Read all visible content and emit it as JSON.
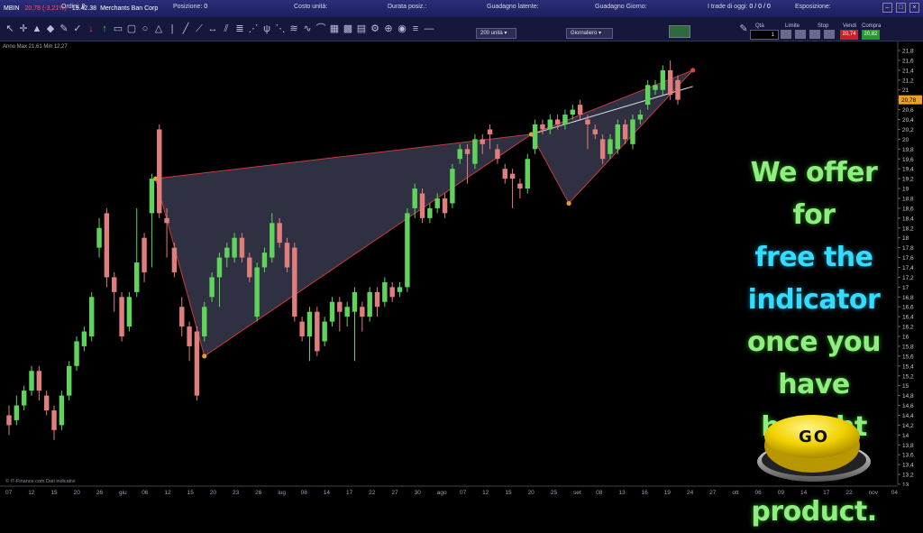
{
  "header": {
    "symbol": "MBIN",
    "change": "20,78 (-3,21%)",
    "time": "19.42.38",
    "name": "Merchants Ban Corp",
    "fields": [
      {
        "label": "Ordini:",
        "value": "0"
      },
      {
        "label": "Posizione:",
        "value": "0"
      },
      {
        "label": "Costo unità:",
        "value": ""
      },
      {
        "label": "Durata posiz.:",
        "value": ""
      },
      {
        "label": "Guadagno latente:",
        "value": ""
      },
      {
        "label": "Guadagno Giorno:",
        "value": ""
      },
      {
        "label": "I trade di oggi:",
        "value": "0 / 0 / 0"
      },
      {
        "label": "Esposizione:",
        "value": ""
      }
    ]
  },
  "toolbar": {
    "units_select": "200 unità",
    "period_select": "Giornaliero",
    "qty_label": "Qtà",
    "qty_value": "1",
    "limit_label": "Limite",
    "stop_label": "Stop",
    "sell_label": "Vendi",
    "sell_price": "20,74",
    "buy_label": "Compra",
    "buy_price": "20,82",
    "sell_color": "#c8202a",
    "buy_color": "#1f9a2e"
  },
  "chart_info": "Anno Max 21,61 Min 12,27",
  "price_tag": "20,78",
  "footer": "© IT-Finance.com Dati indicativi",
  "promo": {
    "lines": [
      "We offer for",
      "free the",
      "indicator",
      "once you",
      "have bought",
      "this product."
    ],
    "go_label": "GO"
  },
  "chart_data": {
    "type": "candlestick",
    "y_ticks": [
      "21,8",
      "21,6",
      "21,4",
      "21,2",
      "21",
      "20,8",
      "20,6",
      "20,4",
      "20,2",
      "20",
      "19,8",
      "19,6",
      "19,4",
      "19,2",
      "19",
      "18,8",
      "18,6",
      "18,4",
      "18,2",
      "18",
      "17,8",
      "17,6",
      "17,4",
      "17,2",
      "17",
      "16,8",
      "16,6",
      "16,4",
      "16,2",
      "16",
      "15,8",
      "15,6",
      "15,4",
      "15,2",
      "15",
      "14,8",
      "14,6",
      "14,4",
      "14,2",
      "14",
      "13,8",
      "13,6",
      "13,4",
      "13,2",
      "13"
    ],
    "ylim": [
      13,
      21.8
    ],
    "x_labels": [
      "07",
      "12",
      "15",
      "20",
      "26",
      "giu",
      "06",
      "12",
      "15",
      "20",
      "23",
      "26",
      "lug",
      "08",
      "14",
      "17",
      "22",
      "27",
      "30",
      "ago",
      "07",
      "12",
      "15",
      "20",
      "25",
      "set",
      "08",
      "13",
      "16",
      "19",
      "24",
      "27",
      "ott",
      "06",
      "09",
      "14",
      "17",
      "22",
      "nov",
      "04"
    ],
    "candles": [
      [
        14.4,
        14.2,
        14.6,
        14.0
      ],
      [
        14.3,
        14.6,
        14.8,
        14.2
      ],
      [
        14.6,
        14.9,
        15.0,
        14.5
      ],
      [
        14.9,
        15.3,
        15.4,
        14.8
      ],
      [
        15.3,
        14.9,
        15.4,
        14.7
      ],
      [
        14.8,
        14.5,
        14.9,
        14.4
      ],
      [
        14.5,
        14.1,
        14.6,
        13.9
      ],
      [
        14.2,
        14.8,
        14.9,
        14.1
      ],
      [
        14.8,
        15.4,
        15.5,
        14.7
      ],
      [
        15.4,
        15.9,
        16.0,
        15.3
      ],
      [
        15.8,
        16.1,
        16.2,
        15.7
      ],
      [
        16.0,
        16.8,
        16.9,
        15.9
      ],
      [
        17.8,
        18.2,
        18.4,
        17.6
      ],
      [
        18.5,
        17.2,
        18.6,
        17.0
      ],
      [
        17.2,
        16.9,
        17.3,
        16.5
      ],
      [
        16.8,
        16.0,
        16.9,
        15.9
      ],
      [
        16.2,
        16.8,
        16.9,
        16.1
      ],
      [
        16.9,
        17.5,
        18.6,
        16.8
      ],
      [
        18.0,
        17.3,
        18.1,
        17.1
      ],
      [
        18.5,
        19.2,
        19.3,
        17.4
      ],
      [
        20.2,
        18.5,
        20.3,
        18.4
      ],
      [
        18.4,
        18.3,
        18.6,
        17.6
      ],
      [
        17.8,
        17.3,
        17.9,
        17.2
      ],
      [
        16.6,
        16.2,
        16.8,
        16.0
      ],
      [
        16.2,
        15.8,
        16.3,
        15.5
      ],
      [
        16.1,
        14.8,
        16.2,
        14.7
      ],
      [
        16.0,
        16.6,
        16.7,
        15.9
      ],
      [
        16.8,
        17.2,
        17.3,
        16.7
      ],
      [
        17.2,
        17.6,
        17.7,
        16.6
      ],
      [
        17.6,
        17.8,
        17.9,
        17.4
      ],
      [
        17.6,
        18.0,
        18.1,
        17.5
      ],
      [
        18.0,
        17.6,
        18.1,
        17.5
      ],
      [
        17.6,
        17.2,
        17.7,
        17.1
      ],
      [
        16.4,
        17.4,
        17.5,
        16.3
      ],
      [
        17.4,
        17.7,
        17.8,
        17.3
      ],
      [
        17.6,
        18.3,
        18.5,
        17.5
      ],
      [
        18.3,
        17.9,
        18.4,
        17.8
      ],
      [
        17.9,
        17.4,
        18.0,
        17.3
      ],
      [
        17.8,
        16.4,
        17.9,
        16.3
      ],
      [
        16.3,
        16.0,
        16.4,
        15.9
      ],
      [
        16.0,
        16.5,
        16.6,
        15.5
      ],
      [
        16.5,
        15.7,
        16.6,
        15.6
      ],
      [
        15.9,
        16.3,
        16.4,
        15.8
      ],
      [
        16.3,
        16.7,
        16.8,
        16.2
      ],
      [
        16.7,
        16.5,
        16.8,
        16.1
      ],
      [
        16.4,
        16.6,
        16.7,
        16.2
      ],
      [
        16.5,
        16.9,
        17.0,
        15.5
      ],
      [
        16.6,
        16.4,
        16.7,
        16.1
      ],
      [
        16.4,
        16.9,
        17.0,
        16.3
      ],
      [
        16.9,
        16.6,
        17.0,
        16.4
      ],
      [
        16.7,
        17.1,
        17.2,
        16.6
      ],
      [
        17.0,
        16.8,
        17.1,
        16.7
      ],
      [
        16.9,
        17.0,
        17.1,
        16.8
      ],
      [
        17.0,
        18.5,
        18.6,
        16.9
      ],
      [
        18.6,
        19.0,
        19.1,
        18.4
      ],
      [
        18.9,
        18.4,
        19.0,
        18.3
      ],
      [
        18.4,
        18.6,
        18.7,
        18.3
      ],
      [
        18.6,
        18.8,
        18.9,
        18.5
      ],
      [
        18.8,
        18.5,
        18.9,
        18.4
      ],
      [
        18.7,
        19.4,
        19.5,
        18.6
      ],
      [
        19.6,
        19.8,
        19.9,
        19.5
      ],
      [
        19.8,
        19.7,
        19.9,
        19.1
      ],
      [
        19.5,
        20.0,
        20.1,
        19.4
      ],
      [
        20.0,
        19.9,
        20.1,
        19.7
      ],
      [
        20.2,
        20.1,
        20.3,
        19.8
      ],
      [
        19.8,
        19.6,
        19.9,
        19.5
      ],
      [
        19.4,
        19.2,
        19.5,
        19.1
      ],
      [
        19.3,
        19.2,
        19.4,
        18.6
      ],
      [
        19.1,
        19.0,
        19.2,
        18.8
      ],
      [
        19.0,
        19.6,
        19.7,
        18.9
      ],
      [
        19.8,
        20.3,
        20.4,
        19.7
      ],
      [
        20.3,
        20.2,
        20.4,
        20.1
      ],
      [
        20.2,
        20.4,
        20.5,
        20.1
      ],
      [
        20.4,
        20.3,
        20.5,
        20.2
      ],
      [
        20.3,
        20.5,
        20.6,
        20.2
      ],
      [
        20.5,
        20.6,
        20.7,
        20.4
      ],
      [
        20.7,
        20.5,
        20.8,
        20.4
      ],
      [
        20.4,
        20.3,
        20.5,
        19.8
      ],
      [
        20.2,
        20.1,
        20.3,
        20.0
      ],
      [
        20.0,
        19.6,
        20.1,
        19.5
      ],
      [
        19.7,
        20.0,
        20.1,
        19.6
      ],
      [
        19.8,
        20.3,
        20.4,
        19.7
      ],
      [
        20.3,
        20.0,
        20.4,
        19.9
      ],
      [
        19.9,
        20.4,
        20.5,
        19.8
      ],
      [
        20.4,
        20.5,
        20.6,
        20.3
      ],
      [
        20.7,
        21.1,
        21.2,
        20.6
      ],
      [
        21.0,
        21.1,
        21.2,
        20.9
      ],
      [
        21.0,
        21.4,
        21.5,
        20.9
      ],
      [
        21.4,
        20.9,
        21.6,
        20.8
      ],
      [
        21.2,
        20.8,
        21.3,
        20.7
      ]
    ],
    "pattern_points": [
      {
        "i": 19.5,
        "v": 19.2
      },
      {
        "i": 26,
        "v": 15.6
      },
      {
        "i": 69.5,
        "v": 20.1
      },
      {
        "i": 74.5,
        "v": 18.7
      },
      {
        "i": 91,
        "v": 21.4
      }
    ],
    "colors": {
      "up": "#5fd35c",
      "down": "#e07e7e",
      "pattern_fill": "#555a78",
      "pattern_line": "#c83a3a"
    }
  }
}
